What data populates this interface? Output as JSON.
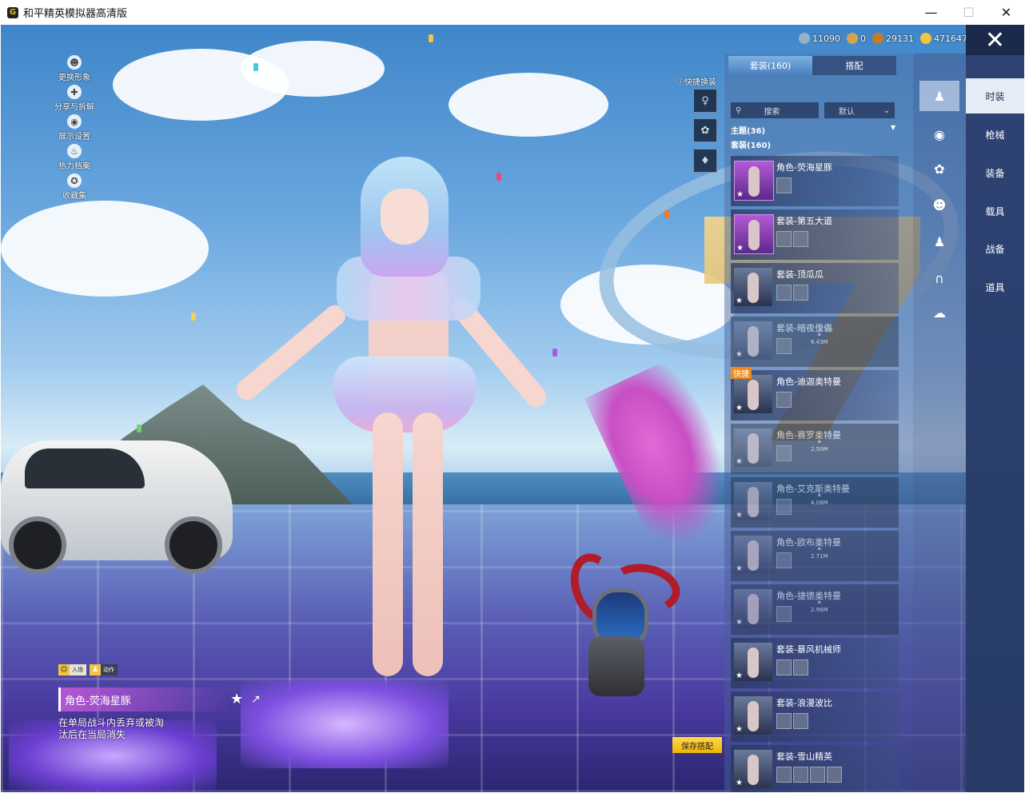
{
  "window": {
    "title": "和平精英模拟器高清版",
    "icon": "app-icon",
    "controls": [
      "minimize",
      "maximize",
      "close"
    ]
  },
  "left_menu": [
    {
      "label": "更换形象",
      "icon": "avatar-icon"
    },
    {
      "label": "分享与拆解",
      "icon": "share-icon"
    },
    {
      "label": "展示设置",
      "icon": "eye-icon"
    },
    {
      "label": "热力档案",
      "icon": "fire-icon"
    },
    {
      "label": "收藏集",
      "icon": "collection-icon"
    }
  ],
  "currencies": [
    {
      "value": "11090",
      "color": "#9ab0c8"
    },
    {
      "value": "0",
      "color": "#d4a34a"
    },
    {
      "value": "29131",
      "color": "#c77a2a"
    },
    {
      "value": "471647",
      "color": "#f2c53a"
    }
  ],
  "quick_change": {
    "label": "快捷换装"
  },
  "panel": {
    "tabs": [
      {
        "label": "套装(160)",
        "active": true
      },
      {
        "label": "搭配",
        "active": false
      }
    ],
    "search_placeholder": "搜索",
    "sort": "默认",
    "filter": "主题(36)",
    "subheader": "套装(160)",
    "items": [
      {
        "name": "角色-荧海星豚",
        "style": "purple",
        "subs": 1,
        "download": null
      },
      {
        "name": "套装-第五大道",
        "style": "purple",
        "subs": 2,
        "download": null
      },
      {
        "name": "套装-顶瓜瓜",
        "style": "normal",
        "subs": 2,
        "download": null
      },
      {
        "name": "套装-暗夜傀儡",
        "style": "dim",
        "subs": 1,
        "download": "6.43M"
      },
      {
        "name": "角色-迪迦奥特曼",
        "style": "normal",
        "subs": 1,
        "download": null,
        "badge": "快捷"
      },
      {
        "name": "角色-赛罗奥特曼",
        "style": "dim",
        "subs": 1,
        "download": "2.50M"
      },
      {
        "name": "角色-艾克斯奥特曼",
        "style": "dim",
        "subs": 1,
        "download": "4.08M"
      },
      {
        "name": "角色-欧布奥特曼",
        "style": "dim",
        "subs": 1,
        "download": "2.71M"
      },
      {
        "name": "角色-捷德奥特曼",
        "style": "dim",
        "subs": 1,
        "download": "2.96M"
      },
      {
        "name": "套装-暴风机械师",
        "style": "normal",
        "subs": 2,
        "download": null
      },
      {
        "name": "套装-浪漫波比",
        "style": "normal",
        "subs": 2,
        "download": null
      },
      {
        "name": "套装-雪山精英",
        "style": "normal",
        "subs": 4,
        "download": null
      }
    ]
  },
  "category_icons": [
    "outfit-icon",
    "accessory-icon",
    "hat-icon",
    "mask-icon",
    "top-icon",
    "pants-icon",
    "shoes-icon"
  ],
  "right_tabs": [
    {
      "label": "时装",
      "active": true
    },
    {
      "label": "枪械",
      "active": false
    },
    {
      "label": "装备",
      "active": false
    },
    {
      "label": "载具",
      "active": false
    },
    {
      "label": "战备",
      "active": false
    },
    {
      "label": "道具",
      "active": false
    }
  ],
  "bottom_info": {
    "tab1": "入场",
    "tab2": "动作",
    "name": "角色-荧海星豚",
    "desc": "在单局战斗内丢弃或被淘汰后在当局消失"
  },
  "save_button": "保存搭配",
  "close_label": "✕"
}
